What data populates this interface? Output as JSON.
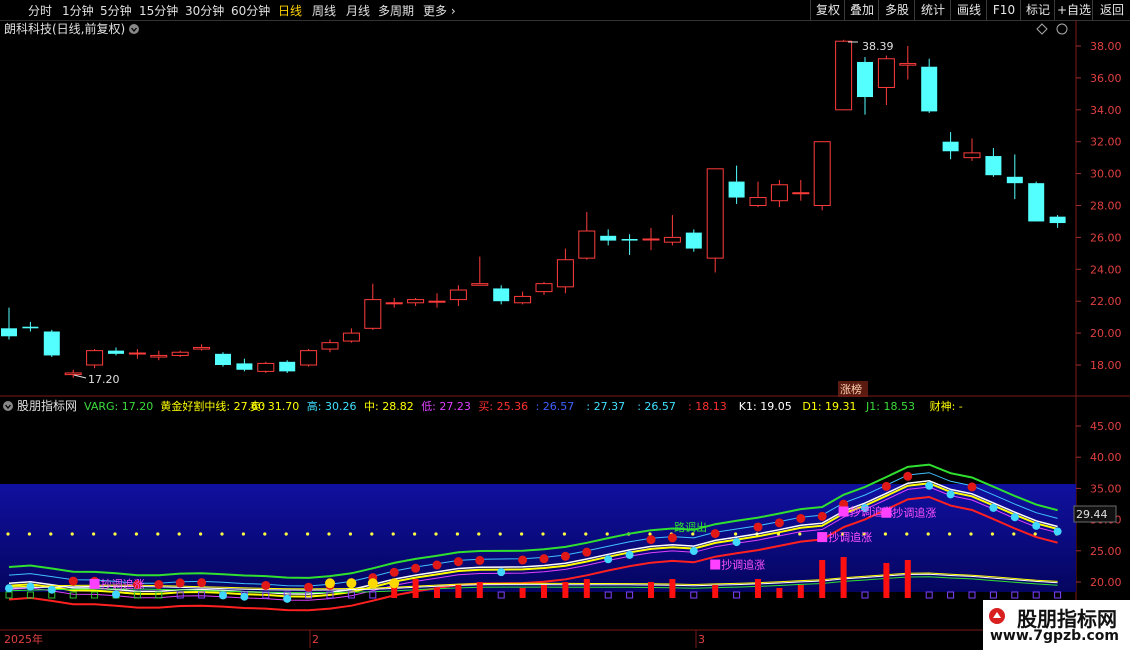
{
  "toolbar": {
    "periods": [
      "分时",
      "1分钟",
      "5分钟",
      "15分钟",
      "30分钟",
      "60分钟",
      "日线",
      "周线",
      "月线",
      "多周期",
      "更多"
    ],
    "active_period": "日线",
    "right_buttons": [
      "复权",
      "叠加",
      "多股",
      "统计",
      "画线",
      "F10",
      "标记",
      "+自选",
      "返回"
    ]
  },
  "main_chart": {
    "title": "朗科科技(日线,前复权)",
    "y_ticks": [
      "38.00",
      "36.00",
      "34.00",
      "32.00",
      "30.00",
      "28.00",
      "26.00",
      "24.00",
      "22.00",
      "20.00",
      "18.00"
    ],
    "high_marker": "38.39",
    "low_marker": "17.20",
    "tag": "涨榜"
  },
  "indicator": {
    "name": "股朋指标网",
    "legend": [
      {
        "text": "VARG: 17.20",
        "color": "#3cdc3c"
      },
      {
        "text": "黄金好割中线: 27.60",
        "color": "#ffff00"
      },
      {
        "text": "卖: 31.70",
        "color": "#ffff00"
      },
      {
        "text": "高: 30.26",
        "color": "#40e0ff"
      },
      {
        "text": "中: 28.82",
        "color": "#ffff00"
      },
      {
        "text": "低: 27.23",
        "color": "#e040ff"
      },
      {
        "text": "买: 25.36",
        "color": "#ff3030"
      },
      {
        "text": ": 26.57",
        "color": "#4060ff"
      },
      {
        "text": ": 27.37",
        "color": "#40e0ff"
      },
      {
        "text": ": 26.57",
        "color": "#40e0ff"
      },
      {
        "text": ": 18.13",
        "color": "#ff3030"
      },
      {
        "text": "K1: 19.05",
        "color": "#ffffff"
      },
      {
        "text": "D1: 19.31",
        "color": "#ffff00"
      },
      {
        "text": "J1: 18.53",
        "color": "#3cdc3c"
      },
      {
        "text": "财神: -",
        "color": "#ffff00"
      }
    ],
    "y_ticks": [
      "45.00",
      "40.00",
      "35.00",
      "30.00",
      "25.00",
      "20.00"
    ],
    "current_value": "29.44",
    "labels": {
      "a": "抄调追涨",
      "b": "抄调追涨",
      "c": "抄调追涨",
      "d": "抄调追涨",
      "e": "抄调追涨",
      "f": "路调出"
    }
  },
  "x_axis": {
    "labels": [
      "2025年",
      "2",
      "3"
    ]
  },
  "watermark": {
    "title": "股朋指标网",
    "url": "www.7gpzb.com"
  },
  "chart_data": {
    "type": "candlestick",
    "title": "朗科科技(日线,前复权)",
    "ylim": [
      17,
      39
    ],
    "candles": [
      {
        "o": 20.3,
        "c": 19.8,
        "h": 21.6,
        "l": 19.6
      },
      {
        "o": 20.4,
        "c": 20.3,
        "h": 20.7,
        "l": 20.1
      },
      {
        "o": 20.1,
        "c": 18.6,
        "h": 20.2,
        "l": 18.5
      },
      {
        "o": 17.4,
        "c": 17.5,
        "h": 17.7,
        "l": 17.2
      },
      {
        "o": 18.0,
        "c": 18.9,
        "h": 19.0,
        "l": 17.8
      },
      {
        "o": 18.9,
        "c": 18.7,
        "h": 19.1,
        "l": 18.6
      },
      {
        "o": 18.7,
        "c": 18.75,
        "h": 19.0,
        "l": 18.4
      },
      {
        "o": 18.5,
        "c": 18.6,
        "h": 18.9,
        "l": 18.3
      },
      {
        "o": 18.6,
        "c": 18.8,
        "h": 18.9,
        "l": 18.5
      },
      {
        "o": 19.0,
        "c": 19.1,
        "h": 19.3,
        "l": 18.9
      },
      {
        "o": 18.7,
        "c": 18.0,
        "h": 18.8,
        "l": 17.9
      },
      {
        "o": 18.1,
        "c": 17.7,
        "h": 18.4,
        "l": 17.6
      },
      {
        "o": 17.6,
        "c": 18.1,
        "h": 18.2,
        "l": 17.5
      },
      {
        "o": 18.2,
        "c": 17.6,
        "h": 18.3,
        "l": 17.5
      },
      {
        "o": 18.0,
        "c": 18.9,
        "h": 19.0,
        "l": 17.9
      },
      {
        "o": 19.0,
        "c": 19.4,
        "h": 19.6,
        "l": 18.8
      },
      {
        "o": 19.5,
        "c": 20.0,
        "h": 20.3,
        "l": 19.4
      },
      {
        "o": 20.3,
        "c": 22.1,
        "h": 23.1,
        "l": 20.2
      },
      {
        "o": 21.9,
        "c": 21.9,
        "h": 22.2,
        "l": 21.6
      },
      {
        "o": 21.9,
        "c": 22.1,
        "h": 22.2,
        "l": 21.7
      },
      {
        "o": 22.0,
        "c": 22.0,
        "h": 22.5,
        "l": 21.6
      },
      {
        "o": 22.1,
        "c": 22.7,
        "h": 23.0,
        "l": 21.7
      },
      {
        "o": 23.0,
        "c": 23.1,
        "h": 24.8,
        "l": 23.0
      },
      {
        "o": 22.8,
        "c": 22.0,
        "h": 23.0,
        "l": 21.8
      },
      {
        "o": 21.9,
        "c": 22.3,
        "h": 22.6,
        "l": 21.8
      },
      {
        "o": 22.6,
        "c": 23.1,
        "h": 23.2,
        "l": 22.4
      },
      {
        "o": 22.9,
        "c": 24.6,
        "h": 25.3,
        "l": 22.5
      },
      {
        "o": 24.7,
        "c": 26.4,
        "h": 27.6,
        "l": 24.6
      },
      {
        "o": 26.1,
        "c": 25.8,
        "h": 26.5,
        "l": 25.5
      },
      {
        "o": 25.9,
        "c": 25.8,
        "h": 26.2,
        "l": 24.9
      },
      {
        "o": 25.9,
        "c": 25.9,
        "h": 26.6,
        "l": 25.2
      },
      {
        "o": 25.7,
        "c": 26.0,
        "h": 27.4,
        "l": 25.5
      },
      {
        "o": 26.3,
        "c": 25.3,
        "h": 26.5,
        "l": 25.1
      },
      {
        "o": 24.7,
        "c": 30.3,
        "h": 30.3,
        "l": 23.8
      },
      {
        "o": 29.5,
        "c": 28.5,
        "h": 30.5,
        "l": 28.1
      },
      {
        "o": 28.0,
        "c": 28.5,
        "h": 29.5,
        "l": 27.9
      },
      {
        "o": 28.3,
        "c": 29.3,
        "h": 29.6,
        "l": 27.9
      },
      {
        "o": 28.8,
        "c": 28.8,
        "h": 29.6,
        "l": 28.3
      },
      {
        "o": 28.0,
        "c": 32.0,
        "h": 32.0,
        "l": 27.7
      },
      {
        "o": 34.0,
        "c": 38.3,
        "h": 38.39,
        "l": 34.0
      },
      {
        "o": 37.0,
        "c": 34.8,
        "h": 37.3,
        "l": 33.7
      },
      {
        "o": 35.4,
        "c": 37.2,
        "h": 37.4,
        "l": 34.3
      },
      {
        "o": 36.8,
        "c": 36.9,
        "h": 38.0,
        "l": 35.9
      },
      {
        "o": 36.7,
        "c": 33.9,
        "h": 37.2,
        "l": 33.8
      },
      {
        "o": 32.0,
        "c": 31.4,
        "h": 32.6,
        "l": 30.9
      },
      {
        "o": 31.0,
        "c": 31.3,
        "h": 32.2,
        "l": 30.8
      },
      {
        "o": 31.1,
        "c": 29.9,
        "h": 31.6,
        "l": 29.8
      },
      {
        "o": 29.8,
        "c": 29.4,
        "h": 31.2,
        "l": 28.4
      },
      {
        "o": 29.4,
        "c": 27.0,
        "h": 29.5,
        "l": 27.0
      },
      {
        "o": 27.3,
        "c": 26.9,
        "h": 27.4,
        "l": 26.6
      }
    ]
  }
}
